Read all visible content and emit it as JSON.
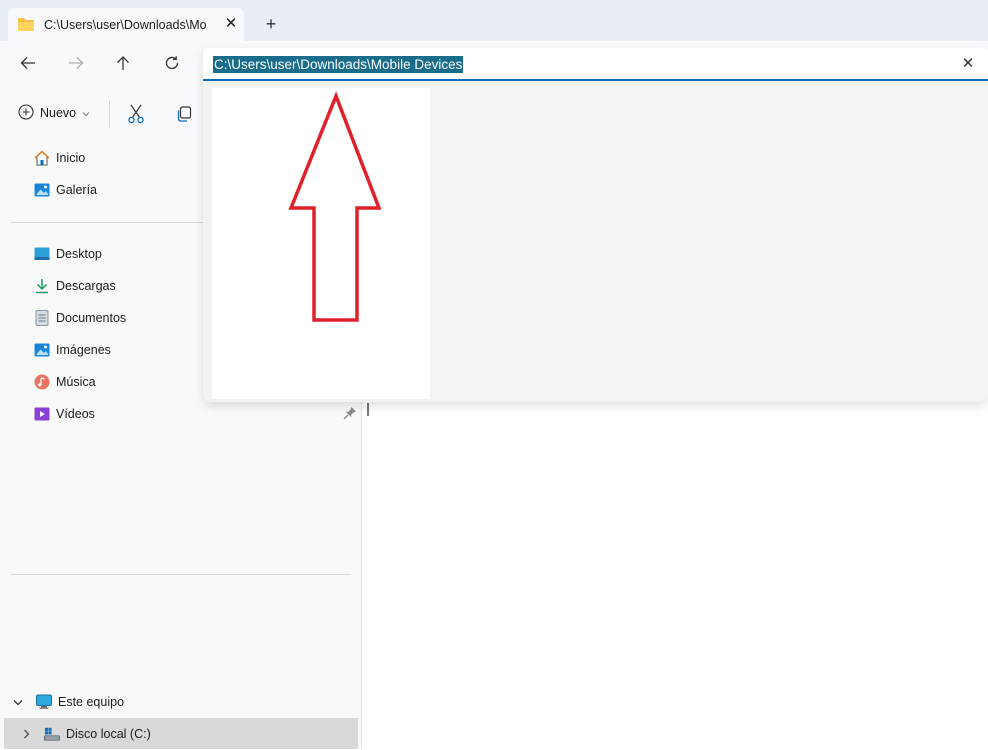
{
  "tab": {
    "title": "C:\\Users\\user\\Downloads\\Mo",
    "close_glyph": "✕",
    "new_tab_glyph": "+"
  },
  "address": {
    "value": "C:\\Users\\user\\Downloads\\Mobile Devices",
    "clear_glyph": "✕"
  },
  "toolbar": {
    "new_label": "Nuevo"
  },
  "sidebar": {
    "quick": [
      {
        "label": "Inicio",
        "icon": "home-icon"
      },
      {
        "label": "Galería",
        "icon": "gallery-icon"
      }
    ],
    "pinned": [
      {
        "label": "Desktop",
        "icon": "desktop-icon"
      },
      {
        "label": "Descargas",
        "icon": "download-icon"
      },
      {
        "label": "Documentos",
        "icon": "documents-icon"
      },
      {
        "label": "Imágenes",
        "icon": "pictures-icon"
      },
      {
        "label": "Música",
        "icon": "music-icon"
      },
      {
        "label": "Vídeos",
        "icon": "videos-icon"
      }
    ],
    "this_pc": {
      "label": "Este equipo",
      "icon": "computer-icon"
    },
    "disk": {
      "label": "Disco local (C:)",
      "icon": "drive-icon"
    }
  },
  "colors": {
    "accent": "#0f6cbd",
    "selection": "#196c8a",
    "annotation_arrow": "#e0202a"
  }
}
